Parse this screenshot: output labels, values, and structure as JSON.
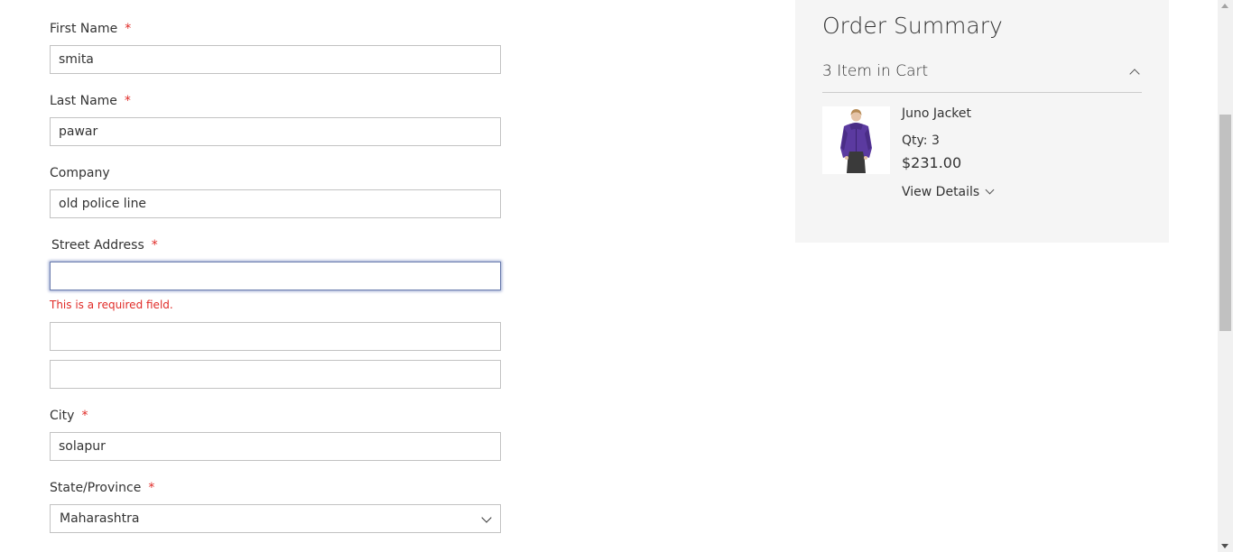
{
  "form": {
    "first_name": {
      "label": "First Name",
      "required": "*",
      "value": "smita"
    },
    "last_name": {
      "label": "Last Name",
      "required": "*",
      "value": "pawar"
    },
    "company": {
      "label": "Company",
      "value": "old police line"
    },
    "street": {
      "label": "Street Address",
      "required": "*",
      "line1": "",
      "line2": "",
      "line3": "",
      "error": "This is a required field."
    },
    "city": {
      "label": "City",
      "required": "*",
      "value": "solapur"
    },
    "state": {
      "label": "State/Province",
      "required": "*",
      "value": "Maharashtra"
    }
  },
  "summary": {
    "title": "Order Summary",
    "cart_count": "3 Item in Cart",
    "item": {
      "name": "Juno Jacket",
      "qty": "Qty: 3",
      "price": "$231.00",
      "view_details": "View Details",
      "image_icon": "purple-jacket-product-photo"
    }
  },
  "colors": {
    "required": "#e02b27",
    "error": "#e02b27",
    "focus_border": "#6a7bad",
    "summary_bg": "#f5f5f5"
  }
}
